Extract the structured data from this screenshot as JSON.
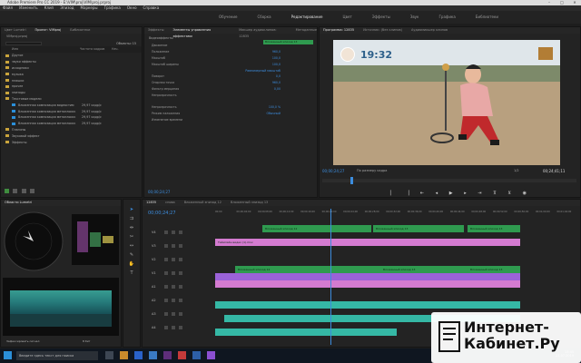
{
  "window": {
    "title": "Adobe Premiere Pro CC 2019 - E:\\VIM\\proj\\VIM\\proj.prproj",
    "minimize": "–",
    "maximize": "□",
    "close": "✕"
  },
  "menu": [
    "Файл",
    "Изменить",
    "Клип",
    "Эпизод",
    "Маркеры",
    "Графика",
    "Окно",
    "Справка"
  ],
  "workspaces": [
    "Обучение",
    "Сборка",
    "Редактирование",
    "Цвет",
    "Эффекты",
    "Звук",
    "Графика",
    "Библиотеки"
  ],
  "project_panel": {
    "tabs": [
      "Цвет Lumetri",
      "Проект: VIMproj",
      "Библиотеки"
    ],
    "path": "VIMproj.prproj",
    "item_count": "Объекты: 15",
    "headers": [
      "Имя",
      "Частота кадров",
      "Нач."
    ],
    "items": [
      {
        "type": "folder",
        "name": "Другое"
      },
      {
        "type": "folder",
        "name": "звуки эффекты"
      },
      {
        "type": "folder",
        "name": "исходники"
      },
      {
        "type": "folder",
        "name": "музыка"
      },
      {
        "type": "folder",
        "name": "плашки"
      },
      {
        "type": "folder",
        "name": "прочее"
      },
      {
        "type": "folder",
        "name": "эпизоды"
      },
      {
        "type": "folder",
        "name": "Текстовые модели"
      },
      {
        "type": "seq",
        "name": "Вложенная композиция видеостим",
        "fps": "29,97 кадр/с"
      },
      {
        "type": "seq",
        "name": "Вложенная композиция металлоиск",
        "fps": "29,97 кадр/с"
      },
      {
        "type": "seq",
        "name": "Вложенная композиция металлоиск",
        "fps": "29,97 кадр/с"
      },
      {
        "type": "seq",
        "name": "Вложенная композиция металлоиск",
        "fps": "29,97 кадр/с"
      },
      {
        "type": "folder",
        "name": "Плагины"
      },
      {
        "type": "folder",
        "name": "Звуковой эффект"
      },
      {
        "type": "folder",
        "name": "Эффекты"
      }
    ]
  },
  "effect_controls": {
    "tabs": [
      "Эффекты",
      "Элементы управления эффектами",
      "Микшер аудиоклипов: 12835",
      "Метаданные"
    ],
    "source": "Видеоэффекты",
    "rows": [
      {
        "label": "Движение",
        "value": ""
      },
      {
        "label": "Положение",
        "value": "960,0"
      },
      {
        "label": "Масштаб",
        "value": "100,0"
      },
      {
        "label": "Масштаб ширины",
        "value": "100,0"
      },
      {
        "label": "",
        "value": "Равномерный масштаб"
      },
      {
        "label": "Поворот",
        "value": "0,0"
      },
      {
        "label": "Опорная точка",
        "value": "960,0"
      },
      {
        "label": "Фильтр мерцания",
        "value": "0,00"
      },
      {
        "label": "Непрозрачность",
        "value": ""
      },
      {
        "label": "",
        "value": ""
      },
      {
        "label": "Непрозрачность",
        "value": "100,0 %"
      },
      {
        "label": "Режим наложения",
        "value": "Обычный"
      },
      {
        "label": "Изменение времени",
        "value": ""
      }
    ],
    "timecode": "00;00;24;27",
    "clip_label": "Вложенный эпизод 13"
  },
  "program_monitor": {
    "tabs": [
      "Программа: 12835",
      "Источник: (без клипов)",
      "Аудиомикшер клипов"
    ],
    "overlay_timer": "19:32",
    "timecode": "00;00;24;27",
    "fit": "По размеру кадра",
    "ratio": "1/2",
    "duration": "00;24;41;11"
  },
  "lumetri_scopes": {
    "tab": "Области Lumetri",
    "values": [
      "100",
      "90",
      "80",
      "70",
      "60",
      "50",
      "40",
      "30",
      "20",
      "10",
      "0"
    ],
    "clamp": "Зафиксировать сигнал",
    "bit": "8 бит"
  },
  "timeline": {
    "tab": "12835",
    "tabs": [
      "12835",
      "снова",
      "Вложенный эпизод 12",
      "Вложенный эпизод 13"
    ],
    "timecode": "00;00;24;27",
    "ruler": [
      "00;00",
      "00;00;04;00",
      "00;00;08;00",
      "00;00;12;00",
      "00;00;16;00",
      "00;00;20;00",
      "00;00;24;00",
      "00;00;28;00",
      "00;00;32;00",
      "00;00;36;00",
      "00;00;40;00",
      "00;00;44;00",
      "00;00;48;00",
      "00;00;52;00",
      "00;00;56;00",
      "00;01;00;00",
      "00;01;04;00"
    ],
    "tracks": [
      "V4",
      "V3",
      "V2",
      "V1",
      "A1",
      "A2",
      "A3",
      "A4"
    ],
    "clip_labels": [
      "Вложенный эпизод 12",
      "Вложенный эпизод 13",
      "Вложенный эпизод 13",
      "Вложенный эпизод 12",
      "Таймлайн видео (1).mov",
      "Вложенный эпизод 13",
      "Вложенный эпизод 13",
      "Вложенный эпизод 12"
    ]
  },
  "taskbar": {
    "time": "13:45",
    "date": "21.07.2019",
    "search": "Введите здесь текст для поиска"
  },
  "watermark": {
    "line1": "Интернет-",
    "line2": "Кабинет.Ру"
  },
  "colors": {
    "accent_blue": "#2b8fd9",
    "clip_green": "#2f9a4f",
    "clip_pink": "#d47bd0",
    "playhead": "#3c8dde"
  }
}
